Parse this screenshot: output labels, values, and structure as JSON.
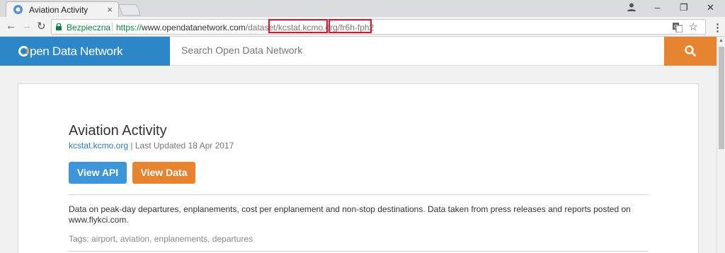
{
  "browser": {
    "tab_title": "Aviation Activity",
    "tab_close": "×",
    "secure_label": "Bezpieczna",
    "url_scheme": "https://",
    "url_host": "www.opendatanetwork.com",
    "url_path": "/dataset/",
    "url_domain": "kcstat.kcmo.org",
    "url_slash": "/",
    "url_id": "fr6h-fph2",
    "minimize": "–",
    "restore": "❐",
    "close": "✕",
    "back": "←",
    "forward": "→",
    "reload": "↻",
    "star": "☆",
    "menu": "⋮"
  },
  "site": {
    "logo_text": "pen Data Network",
    "search_placeholder": "Search Open Data Network",
    "accent_color": "#e68431",
    "header_color": "#2d87c6"
  },
  "dataset": {
    "title": "Aviation Activity",
    "domain": "kcstat.kcmo.org",
    "separator": "|",
    "updated": "Last Updated 18 Apr 2017",
    "view_api": "View API",
    "view_data": "View Data",
    "description": "Data on peak-day departures, enplanements, cost per enplanement and non-stop destinations. Data taken from press releases and reports posted on www.flykci.com.",
    "tags": "Tags: airport, aviation, enplanements, departures"
  }
}
